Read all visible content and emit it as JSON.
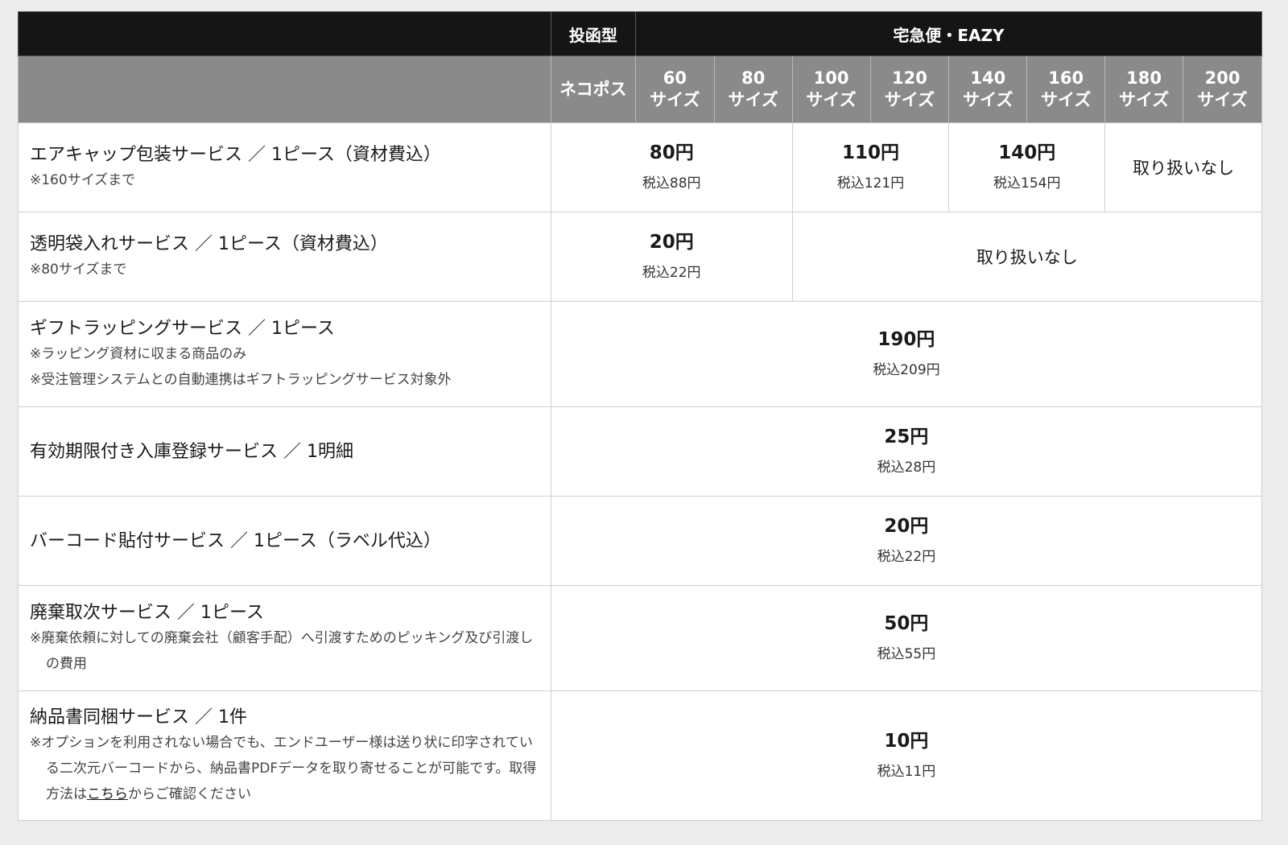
{
  "header": {
    "group_mail": "投函型",
    "group_delivery": "宅急便・EAZY",
    "col_nekopos": "ネコポス",
    "size_labels": [
      "60",
      "80",
      "100",
      "120",
      "140",
      "160",
      "180",
      "200"
    ],
    "size_suffix": "サイズ"
  },
  "rows": [
    {
      "title": "エアキャップ包装サービス ／ 1ピース（資材費込）",
      "notes": [
        "※160サイズまで"
      ],
      "prices": [
        {
          "price": "80円",
          "tax": "税込88円"
        },
        {
          "price": "110円",
          "tax": "税込121円"
        },
        {
          "price": "140円",
          "tax": "税込154円"
        }
      ],
      "not_available": "取り扱いなし"
    },
    {
      "title": "透明袋入れサービス ／ 1ピース（資材費込）",
      "notes": [
        "※80サイズまで"
      ],
      "prices": [
        {
          "price": "20円",
          "tax": "税込22円"
        }
      ],
      "not_available": "取り扱いなし"
    },
    {
      "title": "ギフトラッピングサービス ／ 1ピース",
      "notes": [
        "※ラッピング資材に収まる商品のみ",
        "※受注管理システムとの自動連携はギフトラッピングサービス対象外"
      ],
      "prices": [
        {
          "price": "190円",
          "tax": "税込209円"
        }
      ]
    },
    {
      "title": "有効期限付き入庫登録サービス ／ 1明細",
      "notes": [],
      "prices": [
        {
          "price": "25円",
          "tax": "税込28円"
        }
      ]
    },
    {
      "title": "バーコード貼付サービス ／ 1ピース（ラベル代込）",
      "notes": [],
      "prices": [
        {
          "price": "20円",
          "tax": "税込22円"
        }
      ]
    },
    {
      "title": "廃棄取次サービス ／ 1ピース",
      "notes": [
        "※廃棄依頼に対しての廃棄会社（顧客手配）へ引渡すためのピッキング及び引渡しの費用"
      ],
      "prices": [
        {
          "price": "50円",
          "tax": "税込55円"
        }
      ]
    },
    {
      "title": "納品書同梱サービス ／ 1件",
      "note_before_link": "※オプションを利用されない場合でも、エンドユーザー様は送り状に印字されている二次元バーコードから、納品書PDFデータを取り寄せることが可能です。取得方法は",
      "note_link": "こちら",
      "note_after_link": "からご確認ください",
      "prices": [
        {
          "price": "10円",
          "tax": "税込11円"
        }
      ]
    }
  ],
  "colors": {
    "header_dark": "#151515",
    "header_gray": "#8a8a8a",
    "border": "#cfcfcf",
    "page_bg": "#ececec"
  }
}
